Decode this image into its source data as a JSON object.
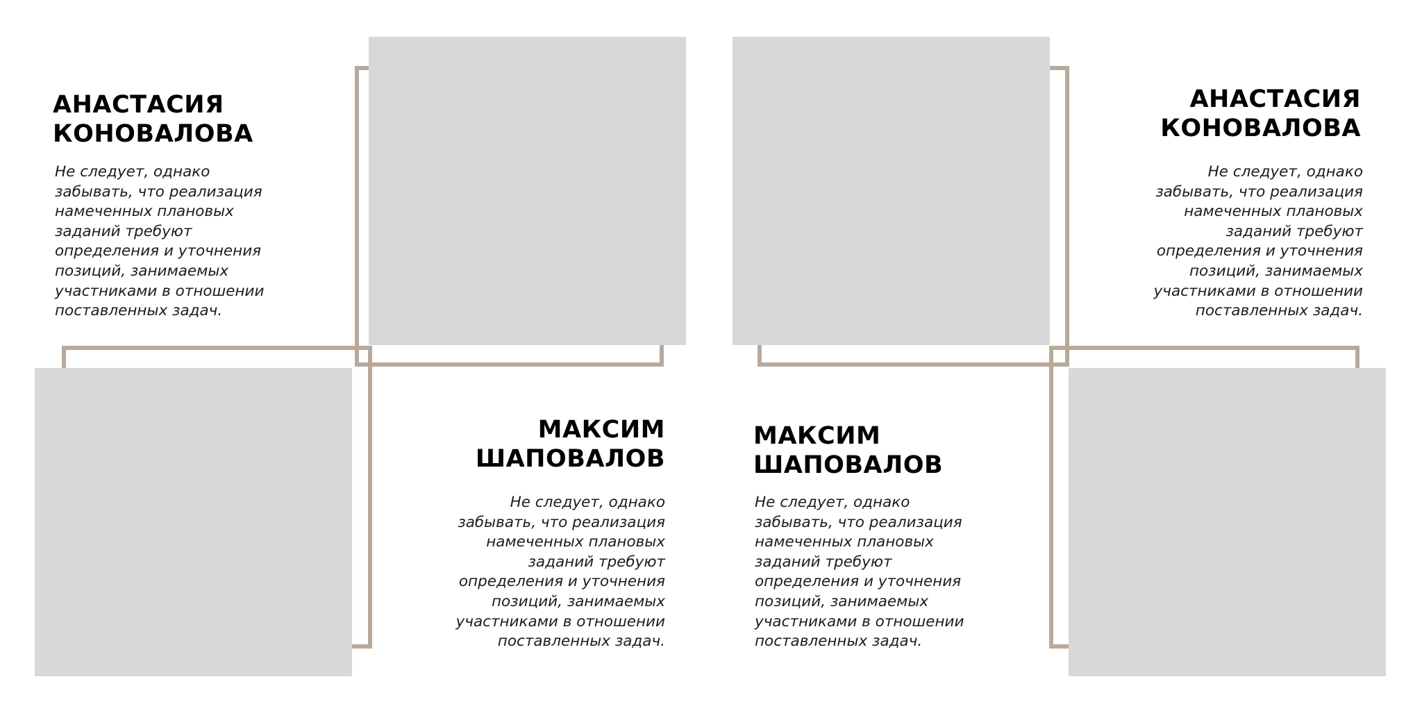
{
  "people": [
    {
      "name": "АНАСТАСИЯ\nКОНОВАЛОВА",
      "bio": "Не следует, однако\nзабывать, что реализация\nнамеченных плановых\nзаданий требуют\nопределения и уточнения\nпозиций, занимаемых\nучастниками в отношении\nпоставленных задач."
    },
    {
      "name": "МАКСИМ\nШАПОВАЛОВ",
      "bio": "Не следует, однако\nзабывать, что реализация\nнамеченных плановых\nзаданий требуют\nопределения и уточнения\nпозиций, занимаемых\nучастниками в отношении\nпоставленных задач."
    },
    {
      "name": "МАКСИМ\nШАПОВАЛОВ",
      "bio": "Не следует, однако\nзабывать, что реализация\nнамеченных плановых\nзаданий требуют\nопределения и уточнения\nпозиций, занимаемых\nучастниками в отношении\nпоставленных задач."
    },
    {
      "name": "АНАСТАСИЯ\nКОНОВАЛОВА",
      "bio": "Не следует, однако\nзабывать, что реализация\nнамеченных плановых\nзаданий требуют\nопределения и уточнения\nпозиций, занимаемых\nучастниками в отношении\nпоставленных задач."
    }
  ],
  "colors": {
    "frame": "#b8a99a",
    "photo_placeholder": "#d8d8d8",
    "text": "#000000"
  }
}
